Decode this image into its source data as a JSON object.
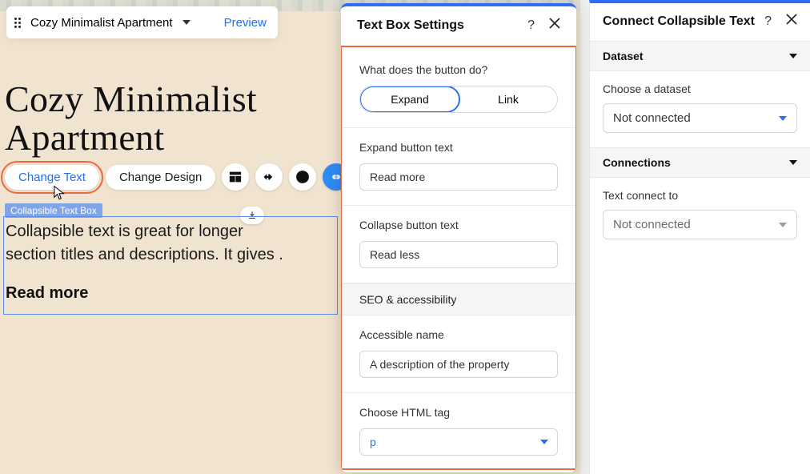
{
  "topbar": {
    "page_name": "Cozy Minimalist Apartment",
    "preview": "Preview"
  },
  "page": {
    "heading_l1": "Cozy Minimalist",
    "heading_l2": "Apartment",
    "element_tag": "Collapsible Text Box",
    "body_l1": "Collapsible text is great for longer",
    "body_l2": "section titles and descriptions. It gives .",
    "readmore": "Read more"
  },
  "toolbar": {
    "change_text": "Change Text",
    "change_design": "Change Design"
  },
  "settings": {
    "title": "Text Box Settings",
    "q1": "What does the button do?",
    "seg_expand": "Expand",
    "seg_link": "Link",
    "expand_label": "Expand button text",
    "expand_value": "Read more",
    "collapse_label": "Collapse button text",
    "collapse_value": "Read less",
    "seo_header": "SEO & accessibility",
    "acc_label": "Accessible name",
    "acc_value": "A description of the property",
    "tag_label": "Choose HTML tag",
    "tag_value": "p"
  },
  "connect": {
    "title": "Connect Collapsible Text",
    "dataset_h": "Dataset",
    "choose_ds": "Choose a dataset",
    "ds_value": "Not connected",
    "conn_h": "Connections",
    "text_to": "Text connect to",
    "text_val": "Not connected"
  }
}
